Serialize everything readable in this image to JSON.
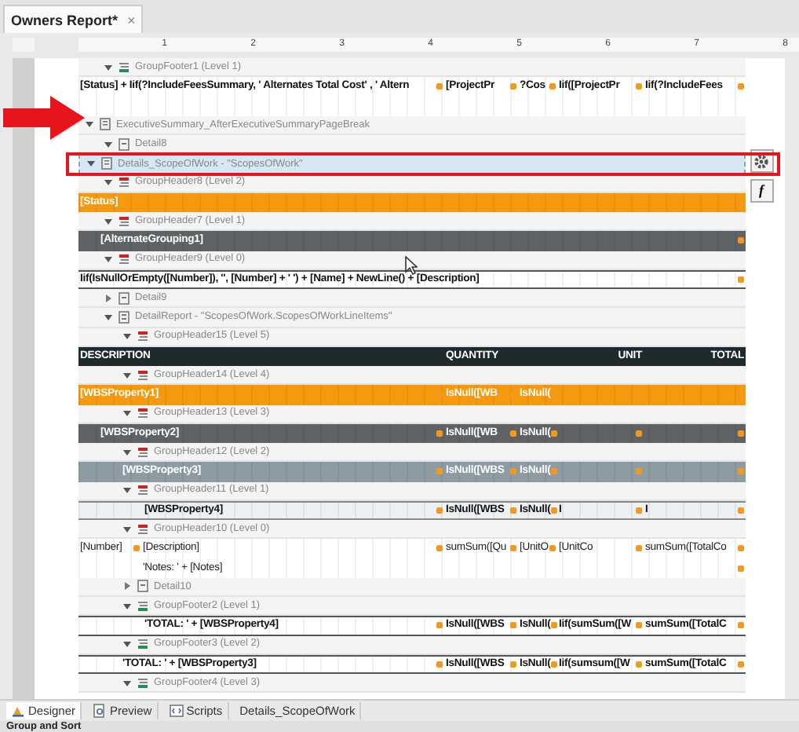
{
  "document_tab": {
    "title": "Owners Report*",
    "close": "×",
    "selected": true
  },
  "ruler": {
    "numbers": [
      "1",
      "2",
      "3",
      "4",
      "5",
      "6",
      "7",
      "8"
    ]
  },
  "side_buttons": [
    {
      "kind": "gear"
    },
    {
      "kind": "formula",
      "label": "f"
    }
  ],
  "continued_bands": [
    {
      "kind": "group_footer",
      "label": "GroupFooter1 (Level 1)",
      "expanded": true,
      "selected": false,
      "rows": [
        {
          "kind": "plain",
          "cells": [
            {
              "text": "[Status] + Iif(?IncludeFeesSummary, ' Alternates Total Cost' , ' Altern",
              "tagged": true
            },
            {
              "text": "[ProjectPr",
              "tagged": true
            },
            {
              "text": "?Cos",
              "tagged": true
            },
            {
              "text": "Iif([ProjectPr",
              "tagged": true
            },
            {
              "text": "Iif(?IncludeFees",
              "tagged": true
            }
          ]
        },
        {
          "kind": "spacer"
        }
      ]
    }
  ],
  "bands": [
    {
      "kind": "report",
      "label": "ExecutiveSummary_AfterExecutiveSummaryPageBreak",
      "expanded": true,
      "selected": false,
      "children": [
        {
          "kind": "detail",
          "label": "Detail8",
          "expanded": true,
          "selected": false
        }
      ]
    },
    {
      "kind": "report",
      "label": "Details_ScopeOfWork - \"ScopesOfWork\"",
      "expanded": true,
      "selected": true,
      "children": [
        {
          "kind": "group_header",
          "label": "GroupHeader8 (Level 2)",
          "expanded": true,
          "selected": false,
          "rows": [
            {
              "kind": "orange",
              "cells": [
                {
                  "text": "[Status]",
                  "tagged": true
                }
              ]
            }
          ]
        },
        {
          "kind": "group_header",
          "label": "GroupHeader7 (Level 1)",
          "expanded": true,
          "selected": false,
          "rows": [
            {
              "kind": "charcoal",
              "cells": [
                {
                  "text": "[AlternateGrouping1]",
                  "tagged": true
                }
              ]
            }
          ]
        },
        {
          "kind": "group_header",
          "label": "GroupHeader9 (Level 0)",
          "expanded": true,
          "selected": false,
          "rows": [
            {
              "kind": "formula",
              "cells": [
                {
                  "text": "Iif(IsNullOrEmpty([Number]), '', [Number] + ' ') + [Name] + NewLine() + [Description]",
                  "tagged": true
                }
              ]
            }
          ]
        },
        {
          "kind": "detail",
          "label": "Detail9",
          "expanded": false,
          "selected": false
        },
        {
          "kind": "detail_report",
          "label": "DetailReport - \"ScopesOfWork.ScopesOfWorkLineItems\"",
          "expanded": true,
          "selected": false,
          "children": [
            {
              "kind": "group_header",
              "label": "GroupHeader15 (Level 5)",
              "expanded": true,
              "selected": false,
              "rows": [
                {
                  "kind": "header",
                  "cells": [
                    {
                      "text": "DESCRIPTION"
                    },
                    {
                      "text": "QUANTITY"
                    },
                    {
                      "text": "UNIT"
                    },
                    {
                      "text": "TOTAL"
                    }
                  ]
                }
              ]
            },
            {
              "kind": "group_header",
              "label": "GroupHeader14 (Level 4)",
              "expanded": true,
              "selected": false,
              "rows": [
                {
                  "kind": "orange",
                  "cells": [
                    {
                      "text": "[WBSProperty1]",
                      "tagged": true
                    },
                    {
                      "text": "IsNull([WB",
                      "tagged": true
                    },
                    {
                      "text": "IsNull(",
                      "tagged": true
                    },
                    {
                      "tagged": true
                    },
                    {
                      "tagged": true
                    }
                  ]
                }
              ]
            },
            {
              "kind": "group_header",
              "label": "GroupHeader13 (Level 3)",
              "expanded": true,
              "selected": false,
              "rows": [
                {
                  "kind": "charcoal",
                  "cells": [
                    {
                      "text": "[WBSProperty2]",
                      "tagged": true
                    },
                    {
                      "text": "IsNull([WB",
                      "tagged": true
                    },
                    {
                      "text": "IsNull(",
                      "tagged": true
                    },
                    {
                      "tagged": true
                    },
                    {
                      "tagged": true
                    }
                  ]
                }
              ]
            },
            {
              "kind": "group_header",
              "label": "GroupHeader12 (Level 2)",
              "expanded": true,
              "selected": false,
              "rows": [
                {
                  "kind": "steel",
                  "cells": [
                    {
                      "text": "[WBSProperty3]",
                      "tagged": true
                    },
                    {
                      "text": "IsNull([WBS",
                      "tagged": true
                    },
                    {
                      "text": "IsNull(",
                      "tagged": true
                    },
                    {
                      "tagged": true
                    },
                    {
                      "tagged": true
                    }
                  ]
                }
              ]
            },
            {
              "kind": "group_header",
              "label": "GroupHeader11 (Level 1)",
              "expanded": true,
              "selected": false,
              "rows": [
                {
                  "kind": "pale",
                  "cells": [
                    {
                      "text": "[WBSProperty4]",
                      "tagged": true
                    },
                    {
                      "text": "IsNull([WBS",
                      "tagged": true
                    },
                    {
                      "text": "IsNull(",
                      "tagged": true
                    },
                    {
                      "text": "I",
                      "tagged": true
                    },
                    {
                      "text": "I",
                      "tagged": true
                    }
                  ]
                }
              ]
            },
            {
              "kind": "group_header",
              "label": "GroupHeader10 (Level 0)",
              "expanded": true,
              "selected": false,
              "rows": [
                {
                  "kind": "light",
                  "cells": [
                    {
                      "text": "[Number]",
                      "tagged": true
                    },
                    {
                      "text": "[Description]",
                      "tagged": true
                    },
                    {
                      "text": "sumSum([Qu",
                      "tagged": true
                    },
                    {
                      "text": "[UnitO",
                      "tagged": true
                    },
                    {
                      "text": "[UnitCo",
                      "tagged": true
                    },
                    {
                      "text": "sumSum([TotalCo",
                      "tagged": true
                    }
                  ]
                },
                {
                  "kind": "light",
                  "cells": [
                    {},
                    {
                      "text": "'Notes: ' + [Notes]",
                      "tagged": true
                    }
                  ]
                }
              ]
            },
            {
              "kind": "detail",
              "label": "Detail10",
              "expanded": false,
              "selected": false
            },
            {
              "kind": "group_footer",
              "label": "GroupFooter2 (Level 1)",
              "expanded": true,
              "selected": false,
              "rows": [
                {
                  "kind": "total",
                  "cells": [
                    {
                      "text": "'TOTAL: ' + [WBSProperty4]",
                      "tagged": true
                    },
                    {
                      "text": "IsNull([WBS",
                      "tagged": true
                    },
                    {
                      "text": "IsNull(",
                      "tagged": true
                    },
                    {
                      "text": "Iif(sumSum([W",
                      "tagged": true
                    },
                    {
                      "text": "sumSum([TotalC",
                      "tagged": true
                    }
                  ]
                }
              ]
            },
            {
              "kind": "group_footer",
              "label": "GroupFooter3 (Level 2)",
              "expanded": true,
              "selected": false,
              "rows": [
                {
                  "kind": "subtotal",
                  "cells": [
                    {
                      "text": "'TOTAL: ' + [WBSProperty3]",
                      "tagged": true
                    },
                    {
                      "text": "IsNull([WBS",
                      "tagged": true
                    },
                    {
                      "text": "IsNull(",
                      "tagged": true
                    },
                    {
                      "text": "Iif(sumsum([W",
                      "tagged": true
                    },
                    {
                      "text": "sumSum([TotalC",
                      "tagged": true
                    }
                  ]
                }
              ]
            },
            {
              "kind": "group_footer",
              "label": "GroupFooter4 (Level 3)",
              "expanded": true,
              "selected": false
            }
          ]
        }
      ]
    }
  ],
  "bottom_tabs": [
    {
      "kind": "designer",
      "label": "Designer",
      "selected": true
    },
    {
      "kind": "preview",
      "label": "Preview",
      "selected": false
    },
    {
      "kind": "scripts",
      "label": "Scripts",
      "selected": false
    },
    {
      "kind": "plain",
      "label": "Details_ScopeOfWork",
      "selected": false
    }
  ],
  "panel_title": "Group and Sort"
}
